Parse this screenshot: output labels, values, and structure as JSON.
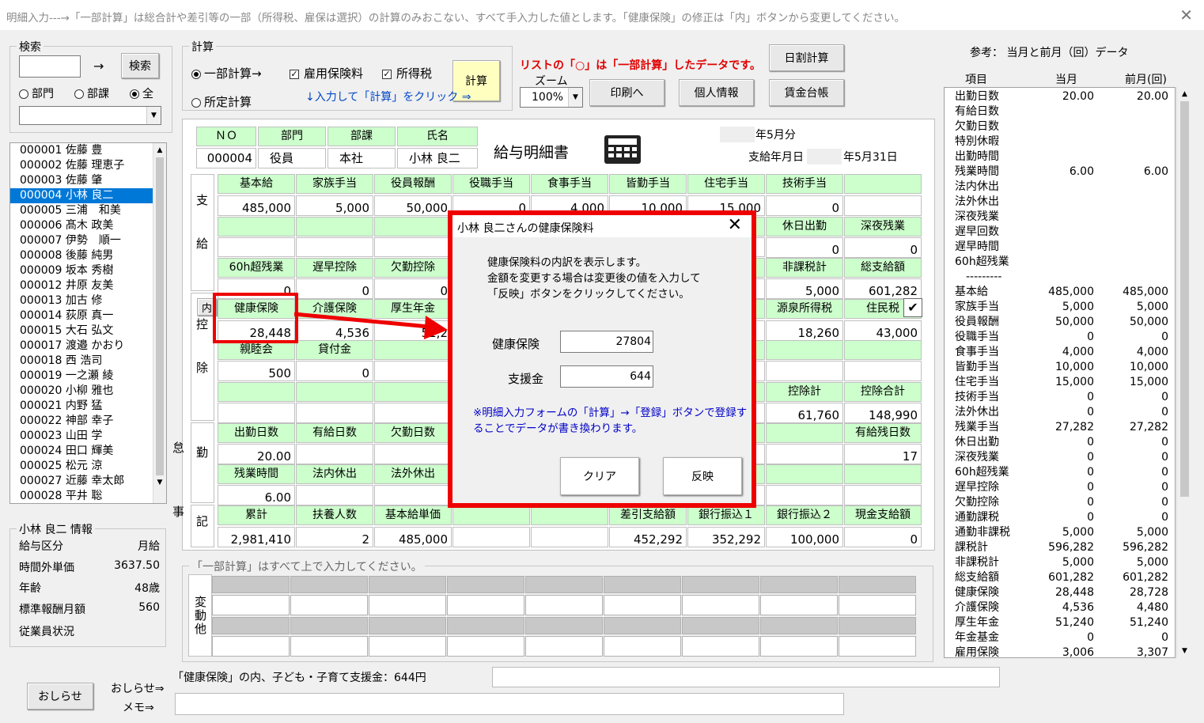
{
  "window": {
    "title": "明細入力---→「一部計算」は総合計や差引等の一部（所得税、雇保は選択）の計算のみおこない、すべて手入力した値とします。「健康保険」の修正は「内」ボタンから変更してください。"
  },
  "search": {
    "legend": "検索",
    "arrow": "→",
    "button": "検索",
    "radio_dept": "部門",
    "radio_sect": "部課",
    "radio_all": "全"
  },
  "employees": [
    "000001 佐藤 豊",
    "000002 佐藤 理恵子",
    "000003 佐藤 肇",
    "000004 小林 良二",
    "000005 三浦　和美",
    "000006 髙木 政美",
    "000007 伊勢　順一",
    "000008 後藤 純男",
    "000009 坂本 秀樹",
    "000012 井原 友美",
    "000013 加古 修",
    "000014 荻原 真一",
    "000015 大石 弘文",
    "000017 渡邉 かおり",
    "000018 西 浩司",
    "000019 一之瀬 綾",
    "000020 小柳 雅也",
    "000021 内野 猛",
    "000022 神部 幸子",
    "000023 山田 学",
    "000024 田口 輝美",
    "000025 松元 涼",
    "000027 近藤 幸太郎",
    "000028 平井 聡"
  ],
  "info": {
    "legend": "小林 良二 情報",
    "rows": [
      {
        "k": "給与区分",
        "v": "月給"
      },
      {
        "k": "時間外単価",
        "v": "3637.50"
      },
      {
        "k": "年齢",
        "v": "48歳"
      },
      {
        "k": "標準報酬月額",
        "v": "560"
      },
      {
        "k": "従業員状況",
        "v": ""
      }
    ]
  },
  "bottom": {
    "notice_button": "おしらせ",
    "notice_link": "おしらせ⇒",
    "memo_link": "メモ⇒",
    "status": "「健康保険」の内、子ども・子育て支援金：644円"
  },
  "calc": {
    "legend": "計算",
    "partial": "一部計算→",
    "fixed": "所定計算",
    "emp_ins": "雇用保険料",
    "income_tax": "所得税",
    "calc_button": "計算",
    "hint": "↓入力して「計算」をクリック ⇒"
  },
  "notice_red": "リストの「○」は「一部計算」したデータです。",
  "zoom": {
    "label": "ズーム",
    "value": "100%"
  },
  "buttons": {
    "print": "印刷へ",
    "personal": "個人情報",
    "daily": "日割計算",
    "ledger": "賃金台帳"
  },
  "ref": {
    "title": "参考： 当月と前月（回）データ",
    "h_item": "項目",
    "h_cur": "当月",
    "h_prev": "前月(回)",
    "rows": [
      [
        "出勤日数",
        "20.00",
        "20.00"
      ],
      [
        "有給日数",
        "",
        ""
      ],
      [
        "欠勤日数",
        "",
        ""
      ],
      [
        "特別休暇",
        "",
        ""
      ],
      [
        "出勤時間",
        "",
        ""
      ],
      [
        "残業時間",
        "6.00",
        "6.00"
      ],
      [
        "法内休出",
        "",
        ""
      ],
      [
        "法外休出",
        "",
        ""
      ],
      [
        "深夜残業",
        "",
        ""
      ],
      [
        "遅早回数",
        "",
        ""
      ],
      [
        "遅早時間",
        "",
        ""
      ],
      [
        "60h超残業",
        "",
        ""
      ],
      [
        "　---------",
        "",
        ""
      ],
      [
        "基本給",
        "485,000",
        "485,000"
      ],
      [
        "家族手当",
        "5,000",
        "5,000"
      ],
      [
        "役員報酬",
        "50,000",
        "50,000"
      ],
      [
        "役職手当",
        "0",
        "0"
      ],
      [
        "食事手当",
        "4,000",
        "4,000"
      ],
      [
        "皆勤手当",
        "10,000",
        "10,000"
      ],
      [
        "住宅手当",
        "15,000",
        "15,000"
      ],
      [
        "技術手当",
        "0",
        "0"
      ],
      [
        "法外休出",
        "0",
        "0"
      ],
      [
        "残業手当",
        "27,282",
        "27,282"
      ],
      [
        "休日出勤",
        "0",
        "0"
      ],
      [
        "深夜残業",
        "0",
        "0"
      ],
      [
        "60h超残業",
        "0",
        "0"
      ],
      [
        "遅早控除",
        "0",
        "0"
      ],
      [
        "欠勤控除",
        "0",
        "0"
      ],
      [
        "通勤課税",
        "0",
        "0"
      ],
      [
        "通勤非課税",
        "5,000",
        "5,000"
      ],
      [
        "課税計",
        "596,282",
        "596,282"
      ],
      [
        "非課税計",
        "5,000",
        "5,000"
      ],
      [
        "総支給額",
        "601,282",
        "601,282"
      ],
      [
        "健康保険",
        "28,448",
        "28,728"
      ],
      [
        "介護保険",
        "4,536",
        "4,480"
      ],
      [
        "厚生年金",
        "51,240",
        "51,240"
      ],
      [
        "年金基金",
        "0",
        "0"
      ],
      [
        "雇用保険",
        "3,006",
        "3,307"
      ]
    ]
  },
  "slip": {
    "title": "給与明細書",
    "no_h": "ＮＯ",
    "dept_h": "部門",
    "sect_h": "部課",
    "name_h": "氏名",
    "no": "000004",
    "dept": "役員",
    "sect": "本社",
    "name": "小林 良二",
    "month": "年5月分",
    "paydate_label": "支給年月日",
    "paydate": "年5月31日"
  },
  "pay": {
    "label": "支給",
    "h1": [
      "基本給",
      "家族手当",
      "役員報酬",
      "役職手当",
      "食事手当",
      "皆勤手当",
      "住宅手当",
      "技術手当",
      ""
    ],
    "v1": [
      "485,000",
      "5,000",
      "50,000",
      "0",
      "4,000",
      "10,000",
      "15,000",
      "0",
      ""
    ],
    "h2": [
      "休日出勤",
      "深夜残業"
    ],
    "v2": [
      "0",
      "0"
    ],
    "h3": [
      "60h超残業",
      "遅早控除",
      "欠勤控除",
      "非課税計",
      "総支給額"
    ],
    "v3": [
      "0",
      "0",
      "0",
      "5,000",
      "601,282"
    ]
  },
  "ded": {
    "label": "控除",
    "inner": "内",
    "h1": [
      "健康保険",
      "介護保険",
      "厚生年金",
      "源泉所得税",
      "住民税"
    ],
    "v1": [
      "28,448",
      "4,536",
      "51,2",
      "18,260",
      "43,000"
    ],
    "h2": [
      "親睦会",
      "貸付金"
    ],
    "v2": [
      "500",
      "0"
    ],
    "h3": [
      "控除計",
      "控除合計"
    ],
    "v3": [
      "61,760",
      "148,990"
    ]
  },
  "att": {
    "label": "勤怠",
    "h1": [
      "出勤日数",
      "有給日数",
      "欠勤日数",
      "有給残日数"
    ],
    "v1": [
      "20.00",
      "",
      "",
      "17"
    ],
    "h2": [
      "残業時間",
      "法内休出",
      "法外休出"
    ],
    "v2": [
      "6.00",
      "",
      ""
    ]
  },
  "note": {
    "label": "記事",
    "h": [
      "累計",
      "扶養人数",
      "基本給単価",
      "",
      "",
      "差引支給額",
      "銀行振込１",
      "銀行振込２",
      "現金支給額"
    ],
    "v": [
      "2,981,410",
      "2",
      "485,000",
      "",
      "",
      "452,292",
      "352,292",
      "100,000",
      "0"
    ]
  },
  "var": {
    "legend": "「一部計算」はすべて上で入力してください。",
    "label": "変動他"
  },
  "modal": {
    "title": "小林 良二さんの健康保険料",
    "desc1": "健康保険料の内訳を表示します。",
    "desc2": "金額を変更する場合は変更後の値を入力して",
    "desc3": "「反映」ボタンをクリックしてください。",
    "f1_label": "健康保険",
    "f1_value": "27804",
    "f2_label": "支援金",
    "f2_value": "644",
    "note1": "※明細入力フォームの「計算」→「登録」ボタンで登録す",
    "note2": "ることでデータが書き換わります。",
    "clear": "クリア",
    "apply": "反映"
  },
  "colors": {
    "header_green": "#ccffcc",
    "highlight_red": "#e00000",
    "selection_blue": "#0078d7",
    "calc_yellow": "#ffffc0"
  }
}
